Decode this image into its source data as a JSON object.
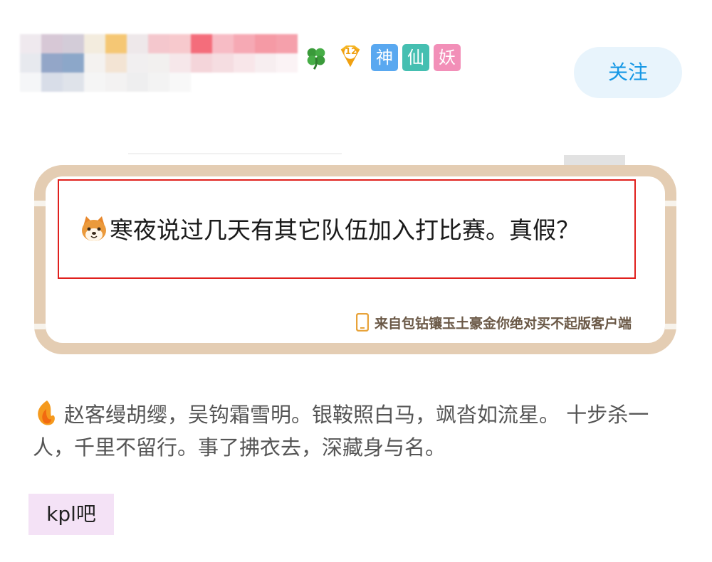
{
  "header": {
    "username_pixel_colors": [
      "#efe9ee",
      "#d7c8d6",
      "#d3ccd8",
      "#f3ecde",
      "#f5c774",
      "#eee8ea",
      "#f4c7cd",
      "#f7c9cd",
      "#f46d7b",
      "#f7bcc5",
      "#f6a9b4",
      "#f59aa5",
      "#f5a0ab",
      "#e7e9ee",
      "#93a6c8",
      "#8ca7c9",
      "#f4f2f0",
      "#f3e4d4",
      "#f1eff0",
      "#f2f0ef",
      "#f6e7ea",
      "#f4d5da",
      "#f5dde1",
      "#f8e6e9",
      "#f7eef0",
      "#fbf3f5",
      "#f5f6f8",
      "#d8dde8",
      "#dfe3ea",
      "#f5f5f5",
      "#f3f2f2",
      "#eeeeef",
      "#f3f3f3",
      "#f8f8f8",
      "#ffffff",
      "#ffffff",
      "#ffffff",
      "#ffffff",
      "#ffffff"
    ],
    "badges": {
      "level": "12",
      "titles": [
        {
          "char": "神",
          "color": "#59a8f0"
        },
        {
          "char": "仙",
          "color": "#45bfb1"
        },
        {
          "char": "妖",
          "color": "#f28fb8"
        }
      ]
    },
    "follow_label": "关注"
  },
  "post": {
    "text": "寒夜说过几天有其它队伍加入打比赛。真假？",
    "source": "来自包钻镶玉土豪金你绝对买不起版客户端"
  },
  "signature": {
    "text": "赵客缦胡缨，吴钩霜雪明。银鞍照白马，飒沓如流星。 十步杀一人，千里不留行。事了拂衣去，深藏身与名。"
  },
  "forum_tag": "kpl吧",
  "colors": {
    "accent_blue": "#1597e5",
    "follow_bg": "#e8f4fc",
    "frame": "#e4cdb3",
    "highlight_red": "#e0201d",
    "tag_bg": "#f4e2f6"
  },
  "icons": [
    "clover-icon",
    "level-diamond-icon",
    "shiba-emoji-icon",
    "phone-icon",
    "flame-icon"
  ]
}
